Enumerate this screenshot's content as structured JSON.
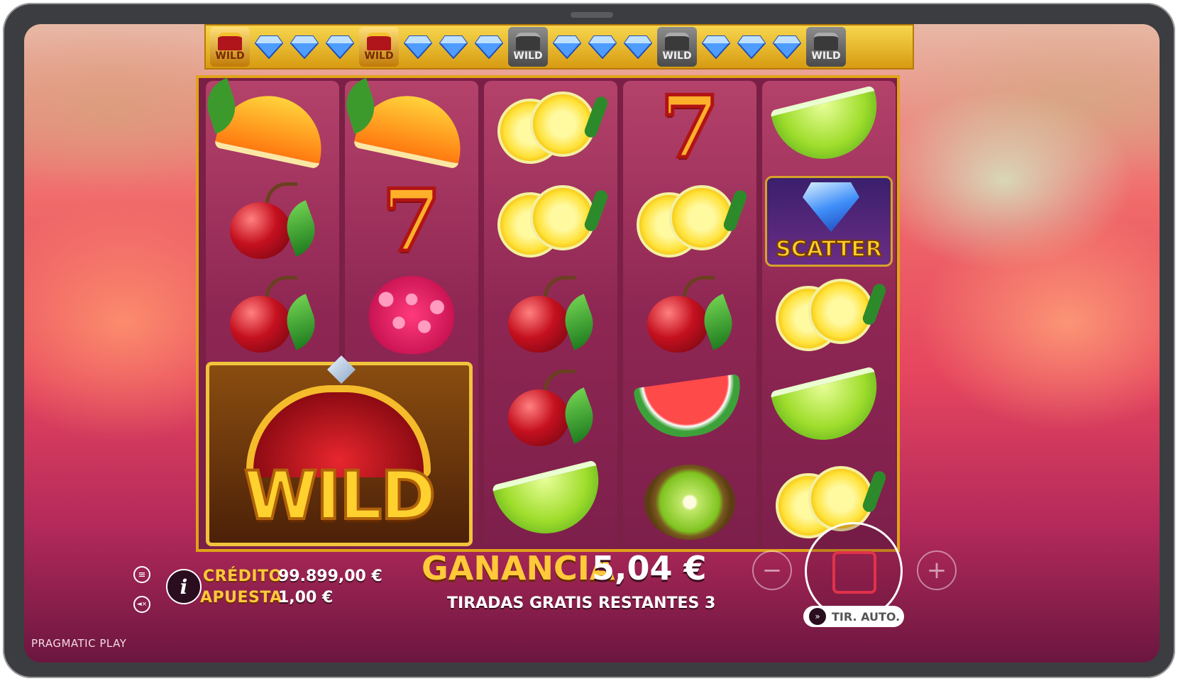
{
  "brand": "PRAGMATIC PLAY",
  "top_bar": {
    "items": [
      {
        "type": "wild",
        "label": "WILD",
        "state": "gold"
      },
      {
        "type": "gem"
      },
      {
        "type": "gem"
      },
      {
        "type": "gem"
      },
      {
        "type": "wild",
        "label": "WILD",
        "state": "gold"
      },
      {
        "type": "gem"
      },
      {
        "type": "gem"
      },
      {
        "type": "gem"
      },
      {
        "type": "wild",
        "label": "WILD",
        "state": "grey"
      },
      {
        "type": "gem"
      },
      {
        "type": "gem"
      },
      {
        "type": "gem"
      },
      {
        "type": "wild",
        "label": "WILD",
        "state": "grey"
      },
      {
        "type": "gem"
      },
      {
        "type": "gem"
      },
      {
        "type": "gem"
      },
      {
        "type": "wild",
        "label": "WILD",
        "state": "grey"
      }
    ]
  },
  "reels": [
    [
      "orange",
      "cherry",
      "cherry",
      "wild",
      "wild"
    ],
    [
      "orange",
      "seven",
      "raspberry",
      "wild",
      "wild"
    ],
    [
      "lemon",
      "lemon",
      "cherry",
      "cherry",
      "lime"
    ],
    [
      "seven",
      "lemon",
      "cherry",
      "watermelon",
      "kiwi"
    ],
    [
      "lime",
      "scatter",
      "lemon",
      "lime",
      "lemon"
    ]
  ],
  "symbols": {
    "seven": "7",
    "scatter": "SCATTER",
    "wild": "WILD"
  },
  "credit": {
    "label": "CRÉDITO",
    "value": "99.899,00 €"
  },
  "bet": {
    "label": "APUESTA",
    "value": "1,00 €"
  },
  "win": {
    "label": "GANANCIA",
    "value": "5,04 €"
  },
  "free_spins_text": "TIRADAS GRATIS RESTANTES 3",
  "controls": {
    "minus": "−",
    "plus": "+",
    "auto_label": "TIR. AUTO.",
    "info": "i",
    "menu_icon": "≡",
    "sound_icon": "◄×"
  },
  "colors": {
    "gold": "#ffc93a",
    "reel": "#8e2653",
    "frame": "#e0a318",
    "stop": "#e0324a"
  }
}
